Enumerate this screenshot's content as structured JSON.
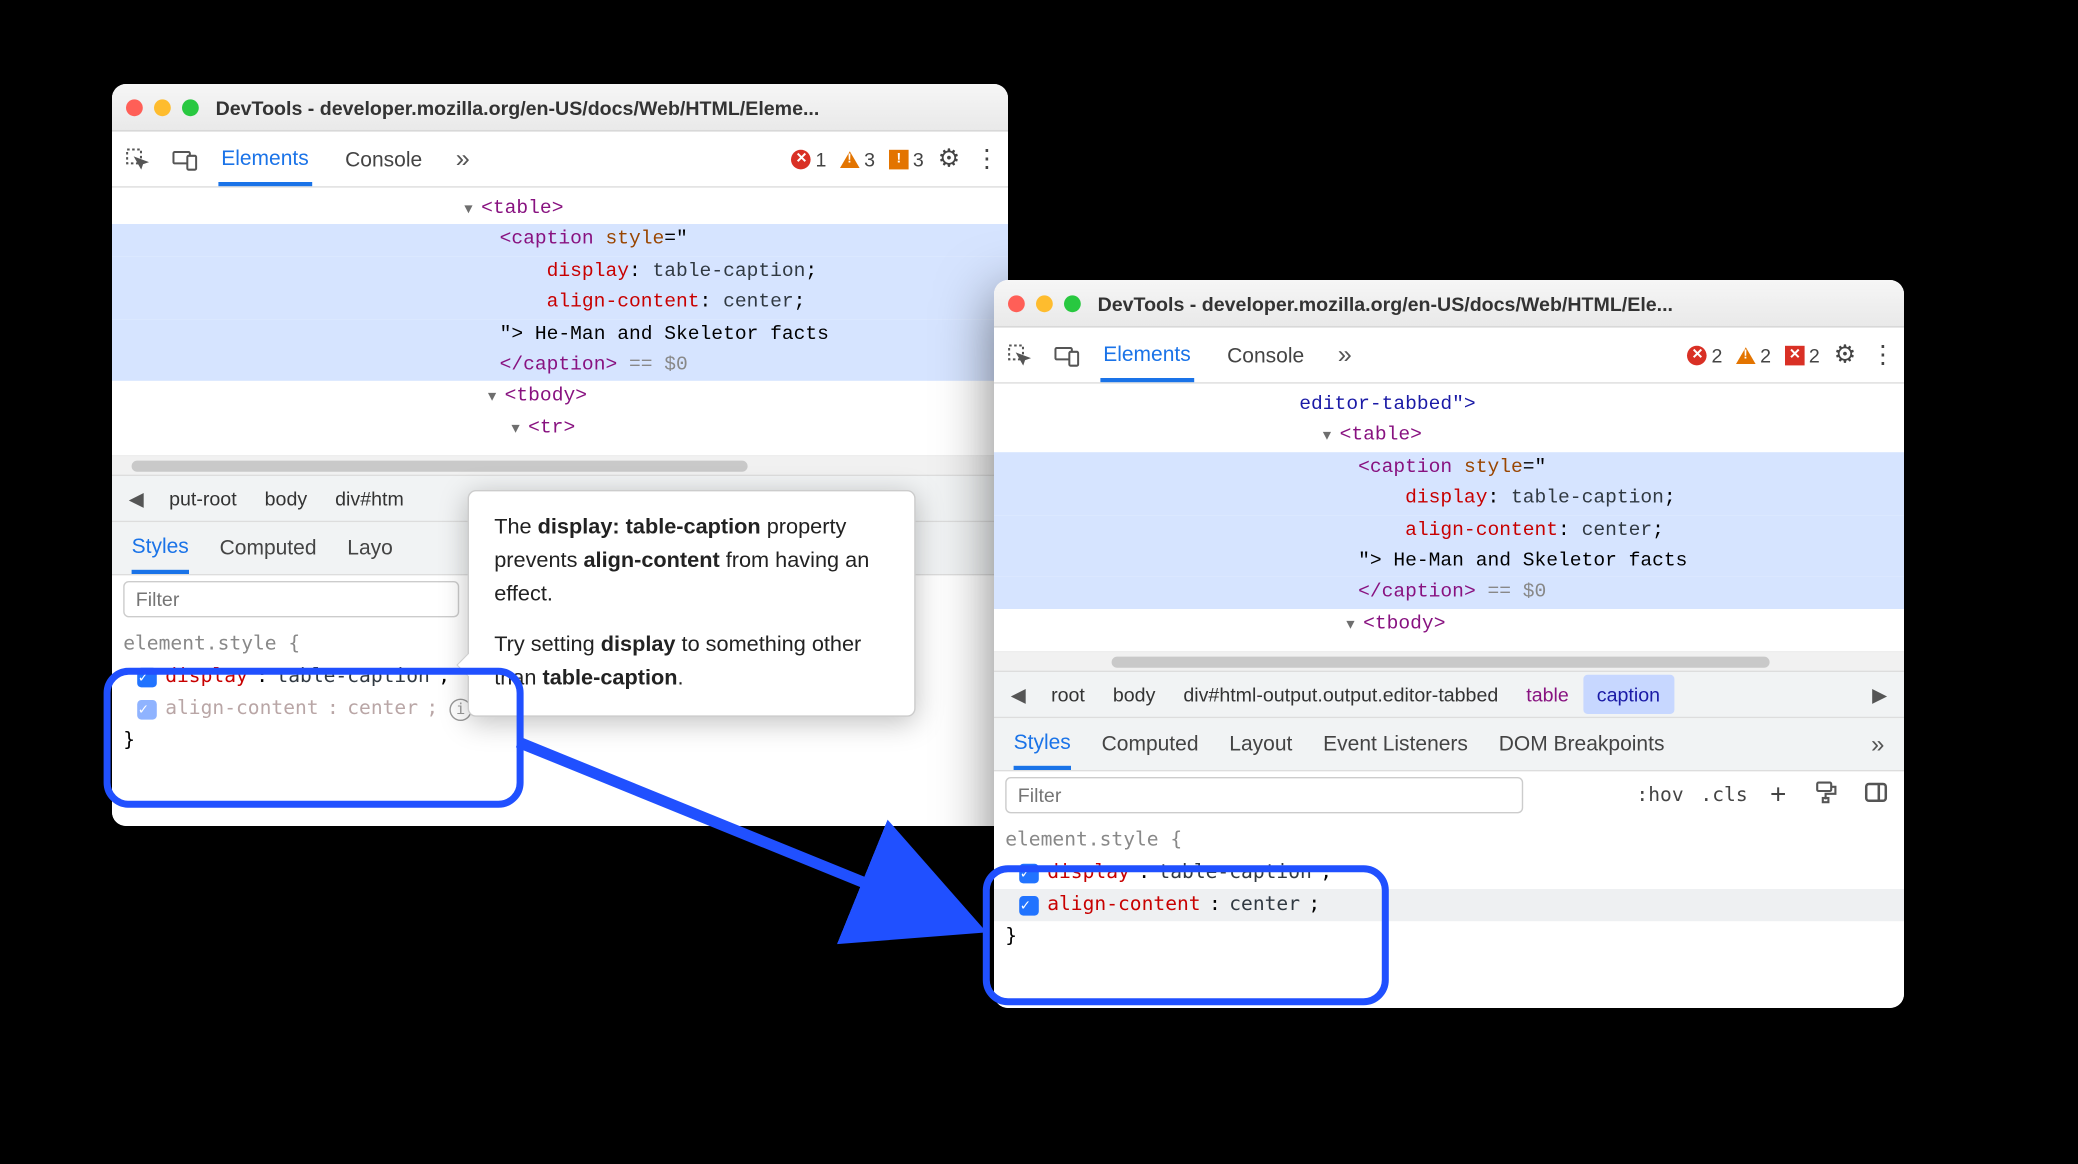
{
  "windowA": {
    "title": "DevTools - developer.mozilla.org/en-US/docs/Web/HTML/Eleme...",
    "tabs": {
      "elements": "Elements",
      "console": "Console"
    },
    "counts": {
      "errors": "1",
      "warnings": "3",
      "issues": "3"
    },
    "dom": {
      "l1": "<table>",
      "l2a": "<caption",
      "l2b": "style",
      "l2c": "=\"",
      "l3a": "display",
      "l3b": ": ",
      "l3c": "table-caption",
      "l3d": ";",
      "l4a": "align-content",
      "l4b": ": ",
      "l4c": "center",
      "l4d": ";",
      "l5a": "\">",
      "l5b": " He-Man and Skeletor facts",
      "l6a": "</caption>",
      "l6b": " == $0",
      "l7": "<tbody>",
      "l8": "<tr>"
    },
    "crumbs": {
      "nav_left": "◀",
      "c1": "put-root",
      "c2": "body",
      "c3": "div#htm"
    },
    "subtabs": {
      "styles": "Styles",
      "computed": "Computed",
      "layout": "Layo"
    },
    "filter_placeholder": "Filter",
    "styles": {
      "selector": "element.style {",
      "r1_prop": "display",
      "r1_val": "table-caption",
      "r2_prop": "align-content",
      "r2_val": "center",
      "close": "}"
    }
  },
  "tooltip": {
    "p1a": "The ",
    "p1b": "display: table-caption",
    "p1c": " property prevents ",
    "p1d": "align-content",
    "p1e": " from having an effect.",
    "p2a": "Try setting ",
    "p2b": "display",
    "p2c": " to something other than ",
    "p2d": "table-caption",
    "p2e": "."
  },
  "windowB": {
    "title": "DevTools - developer.mozilla.org/en-US/docs/Web/HTML/Ele...",
    "tabs": {
      "elements": "Elements",
      "console": "Console"
    },
    "counts": {
      "errors": "2",
      "warnings": "2",
      "issues": "2"
    },
    "dom": {
      "l0": "editor-tabbed\">",
      "l1": "<table>",
      "l2a": "<caption",
      "l2b": "style",
      "l2c": "=\"",
      "l3a": "display",
      "l3b": ": ",
      "l3c": "table-caption",
      "l3d": ";",
      "l4a": "align-content",
      "l4b": ": ",
      "l4c": "center",
      "l4d": ";",
      "l5a": "\">",
      "l5b": " He-Man and Skeletor facts",
      "l6a": "</caption>",
      "l6b": " == $0",
      "l7": "<tbody>"
    },
    "crumbs": {
      "nav_left": "◀",
      "nav_right": "▶",
      "c1": "root",
      "c2": "body",
      "c3": "div#html-output.output.editor-tabbed",
      "c4": "table",
      "c5": "caption"
    },
    "subtabs": {
      "styles": "Styles",
      "computed": "Computed",
      "layout": "Layout",
      "event": "Event Listeners",
      "dom": "DOM Breakpoints"
    },
    "filter_placeholder": "Filter",
    "filter_tools": {
      "hov": ":hov",
      "cls": ".cls"
    },
    "styles": {
      "selector": "element.style {",
      "r1_prop": "display",
      "r1_val": "table-caption",
      "r2_prop": "align-content",
      "r2_val": "center",
      "close": "}"
    }
  }
}
